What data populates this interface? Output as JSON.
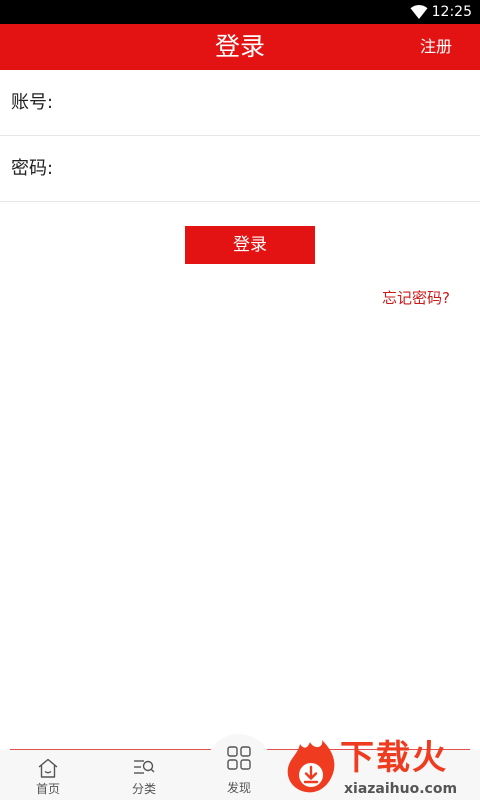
{
  "status_bar": {
    "time": "12:25",
    "icons": [
      "wifi-icon"
    ]
  },
  "header": {
    "title": "登录",
    "register_label": "注册"
  },
  "form": {
    "account_label": "账号:",
    "account_value": "",
    "password_label": "密码:",
    "password_value": ""
  },
  "login_button_label": "登录",
  "forgot_password_label": "忘记密码?",
  "bottom_nav": {
    "items": [
      {
        "label": "首页",
        "icon": "home-icon"
      },
      {
        "label": "分类",
        "icon": "category-search-icon"
      },
      {
        "label": "发现",
        "icon": "grid-icon"
      }
    ]
  },
  "watermark": {
    "title": "下载火",
    "url": "xiazaihuo.com"
  },
  "colors": {
    "accent": "#e31313",
    "link": "#cc1a1a",
    "watermark": "#ef3b1f"
  }
}
